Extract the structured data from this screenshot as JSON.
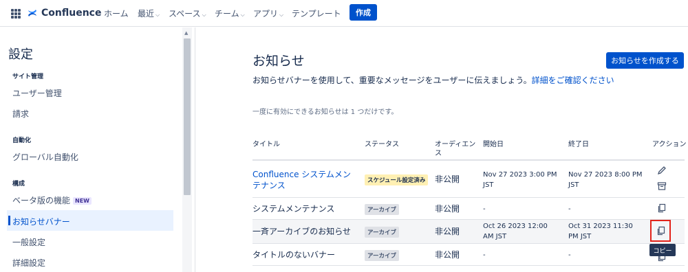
{
  "topnav": {
    "logo_text": "Confluence",
    "items": [
      {
        "label": "ホーム",
        "dropdown": false
      },
      {
        "label": "最近",
        "dropdown": true
      },
      {
        "label": "スペース",
        "dropdown": true
      },
      {
        "label": "チーム",
        "dropdown": true
      },
      {
        "label": "アプリ",
        "dropdown": true
      },
      {
        "label": "テンプレート",
        "dropdown": false
      }
    ],
    "create_label": "作成"
  },
  "sidebar": {
    "title": "設定",
    "sections": [
      {
        "label": "サイト管理",
        "items": [
          "ユーザー管理",
          "請求"
        ]
      },
      {
        "label": "自動化",
        "items": [
          "グローバル自動化"
        ]
      },
      {
        "label": "構成",
        "items": [
          "ベータ版の機能",
          "お知らせバナー",
          "一般設定",
          "詳細設定"
        ]
      }
    ],
    "beta_badge": "NEW",
    "active_item": "お知らせバナー"
  },
  "main": {
    "title": "お知らせ",
    "create_button": "お知らせを作成する",
    "description": "お知らせバナーを使用して、重要なメッセージをユーザーに伝えましょう。",
    "details_link": "詳細をご確認ください",
    "note": "一度に有効にできるお知らせは 1 つだけです。",
    "table": {
      "headers": [
        "タイトル",
        "ステータス",
        "オーディエンス",
        "開始日",
        "終了日",
        "アクション"
      ],
      "rows": [
        {
          "title": "Confluence システムメンテナンス",
          "status": "スケジュール設定済み",
          "audience": "非公開",
          "start": "Nov 27 2023 3:00 PM JST",
          "end": "Nov 27 2023 8:00 PM JST",
          "actions": [
            "pencil-icon",
            "archive-icon"
          ]
        },
        {
          "title": "システムメンテナンス",
          "status": "アーカイブ",
          "audience": "非公開",
          "start": "-",
          "end": "-",
          "actions": [
            "copy-icon"
          ]
        },
        {
          "title": "一斉アーカイブのお知らせ",
          "status": "アーカイブ",
          "audience": "非公開",
          "start": "Oct 26 2023 12:00 AM JST",
          "end": "Oct 31 2023 11:30 PM JST",
          "actions": [
            "copy-icon"
          ]
        },
        {
          "title": "タイトルのないバナー",
          "status": "アーカイブ",
          "audience": "非公開",
          "start": "-",
          "end": "-",
          "actions": [
            "copy-icon"
          ]
        }
      ]
    },
    "tooltip": "コピー"
  },
  "colors": {
    "accent": "#0052cc",
    "highlight": "#e2231a"
  }
}
